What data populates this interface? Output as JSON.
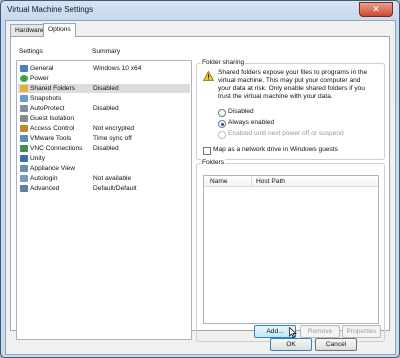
{
  "window": {
    "title": "Virtual Machine Settings",
    "close_glyph": "✕"
  },
  "tabs": [
    {
      "label": "Hardware"
    },
    {
      "label": "Options"
    }
  ],
  "settings_list": {
    "headers": {
      "settings": "Settings",
      "summary": "Summary"
    },
    "rows": [
      {
        "label": "General",
        "value": "Windows 10 x64",
        "icon": "general-icon",
        "color": "#4a7fc1"
      },
      {
        "label": "Power",
        "value": "",
        "icon": "power-icon",
        "color": "#3aa640"
      },
      {
        "label": "Shared Folders",
        "value": "Disabled",
        "icon": "shared-folders-icon",
        "color": "#e0b040"
      },
      {
        "label": "Snapshots",
        "value": "",
        "icon": "snapshots-icon",
        "color": "#6a9bd0"
      },
      {
        "label": "AutoProtect",
        "value": "Disabled",
        "icon": "autoprotect-icon",
        "color": "#7f8f9f"
      },
      {
        "label": "Guest Isolation",
        "value": "",
        "icon": "guest-isolation-icon",
        "color": "#8a8a8a"
      },
      {
        "label": "Access Control",
        "value": "Not encrypted",
        "icon": "access-control-icon",
        "color": "#c08a30"
      },
      {
        "label": "VMware Tools",
        "value": "Time sync off",
        "icon": "vmware-tools-icon",
        "color": "#5a8ac0"
      },
      {
        "label": "VNC Connections",
        "value": "Disabled",
        "icon": "vnc-connections-icon",
        "color": "#4d8a4d"
      },
      {
        "label": "Unity",
        "value": "",
        "icon": "unity-icon",
        "color": "#3b6fb0"
      },
      {
        "label": "Appliance View",
        "value": "",
        "icon": "appliance-view-icon",
        "color": "#6f8ea8"
      },
      {
        "label": "Autologin",
        "value": "Not available",
        "icon": "autologin-icon",
        "color": "#7a9ab8"
      },
      {
        "label": "Advanced",
        "value": "Default/Default",
        "icon": "advanced-icon",
        "color": "#5f7f9f"
      }
    ],
    "selected_index": 2
  },
  "folder_sharing": {
    "group_label": "Folder sharing",
    "warning_lines": [
      "Shared folders expose your files to programs in the",
      "virtual machine. This may put your computer and",
      "your data at risk. Only enable shared folders if you",
      "trust the virtual machine with your data."
    ],
    "options": [
      {
        "label": "Disabled",
        "selected": false,
        "enabled": true
      },
      {
        "label": "Always enabled",
        "selected": true,
        "enabled": true
      },
      {
        "label": "Enabled until next power off or suspend",
        "selected": false,
        "enabled": false
      }
    ],
    "map_drive_label": "Map as a network drive in Windows guests"
  },
  "folders": {
    "group_label": "Folders",
    "headers": {
      "name": "Name",
      "host_path": "Host Path"
    },
    "buttons": {
      "add": "Add...",
      "remove": "Remove",
      "properties": "Properties"
    }
  },
  "footer": {
    "ok": "OK",
    "cancel": "Cancel"
  }
}
